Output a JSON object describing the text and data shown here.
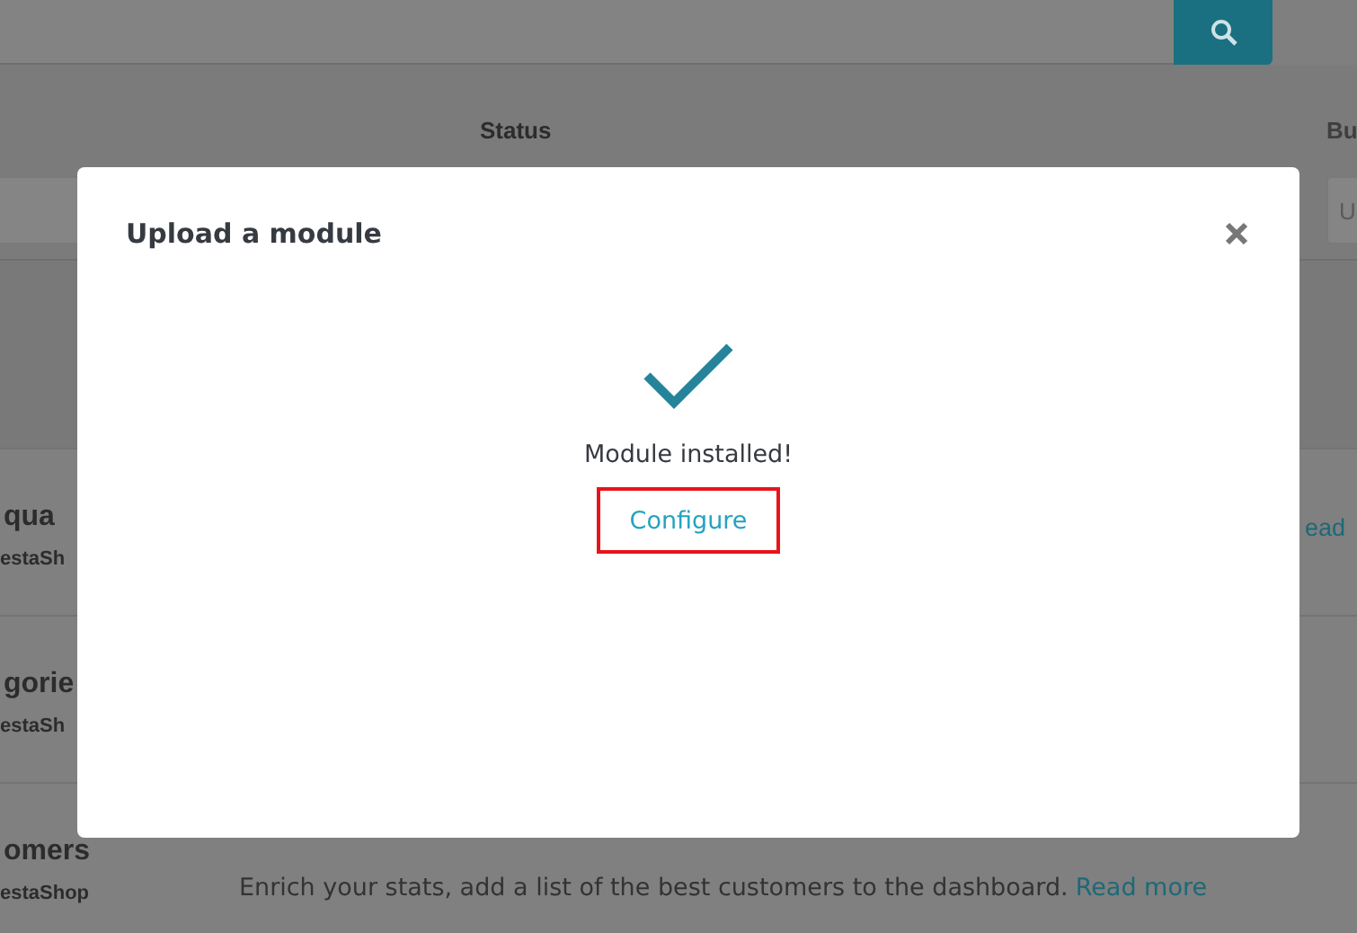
{
  "table": {
    "columns": [
      {
        "label": "Status"
      },
      {
        "label": "Bu"
      }
    ],
    "filter_field": {
      "placeholder": "U"
    }
  },
  "modules": [
    {
      "name": "qua",
      "author": "estaSh",
      "read_more": "ead"
    },
    {
      "name": "gorie",
      "author": "estaSh"
    },
    {
      "name": "omers",
      "author": "estaShop",
      "description": "Enrich your stats, add a list of the best customers to the dashboard.",
      "read_more": "Read more"
    }
  ],
  "modal": {
    "title": "Upload a module",
    "message": "Module installed!",
    "button": {
      "label": "Configure",
      "highlighted": true
    }
  }
}
